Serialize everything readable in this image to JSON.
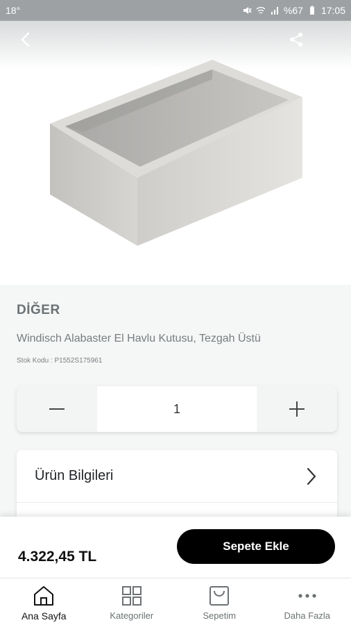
{
  "status_bar": {
    "temperature": "18°",
    "battery": "%67",
    "time": "17:05"
  },
  "product": {
    "category": "DİĞER",
    "title": "Windisch Alabaster El Havlu Kutusu, Tezgah Üstü",
    "sku": "Stok Kodu : P1552S175961",
    "quantity": "1",
    "price": "4.322,45 TL"
  },
  "sections": {
    "info_label": "Ürün Bilgileri"
  },
  "buy": {
    "add_to_cart_label": "Sepete Ekle"
  },
  "tabs": [
    {
      "label": "Ana Sayfa",
      "icon": "home-icon",
      "active": true
    },
    {
      "label": "Kategoriler",
      "icon": "grid-icon",
      "active": false
    },
    {
      "label": "Sepetim",
      "icon": "bag-icon",
      "active": false
    },
    {
      "label": "Daha Fazla",
      "icon": "more-icon",
      "active": false
    }
  ],
  "colors": {
    "accent": "#000000",
    "status_bar": "#9ea1a3"
  }
}
